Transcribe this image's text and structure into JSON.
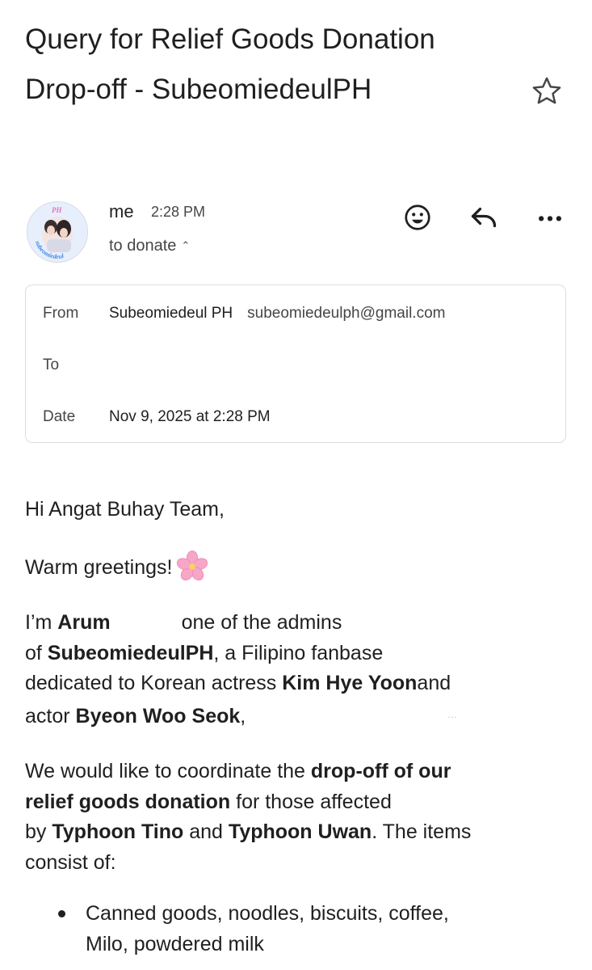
{
  "email": {
    "subject": "Query for Relief Goods Donation Drop-off - SubeomiedeulPH",
    "sender": {
      "name": "me",
      "time": "2:28 PM",
      "to_line": "to donate"
    },
    "avatar": {
      "top_text": "PH",
      "ring_text": "subeomiedeul"
    },
    "details": {
      "from_label": "From",
      "from_name": "Subeomiedeul PH",
      "from_email": "subeomiedeulph@gmail.com",
      "to_label": "To",
      "to_value": "",
      "date_label": "Date",
      "date_value": "Nov 9, 2025 at 2:28 PM"
    },
    "body": {
      "greeting": "Hi Angat Buhay Team,",
      "warm": "Warm greetings!",
      "p1": {
        "t1": "I’m ",
        "name": "Arum",
        "t2": "one of the admins",
        "t3": "of ",
        "fanbase": "SubeomiedeulPH",
        "t4": ", a Filipino fanbase",
        "t5": "dedicated to Korean actress ",
        "actress": "Kim Hye Yoon",
        "t6": "and",
        "t7": "actor ",
        "actor": "Byeon Woo Seok",
        "t8": ",",
        "faint": "..."
      },
      "p2": {
        "t1": "We would like to coordinate the ",
        "b1": "drop-off of our",
        "b2": "relief goods donation",
        "t2": " for those affected",
        "t3": "by ",
        "b3": "Typhoon Tino",
        "t4": " and ",
        "b4": "Typhoon Uwan",
        "t5": ". The items",
        "t6": "consist of:"
      },
      "items": [
        {
          "line1": "Canned goods, noodles, biscuits, coffee,",
          "line2": "Milo, powdered milk"
        }
      ]
    }
  },
  "icons": [
    "star-icon",
    "emoji-reaction-icon",
    "reply-icon",
    "more-options-icon",
    "cherry-blossom-icon",
    "chevron-up-icon"
  ],
  "colors": {
    "text": "#1f1f1f",
    "secondary": "#444746",
    "border": "#dadce0",
    "blossom": "#f6a6c6"
  }
}
